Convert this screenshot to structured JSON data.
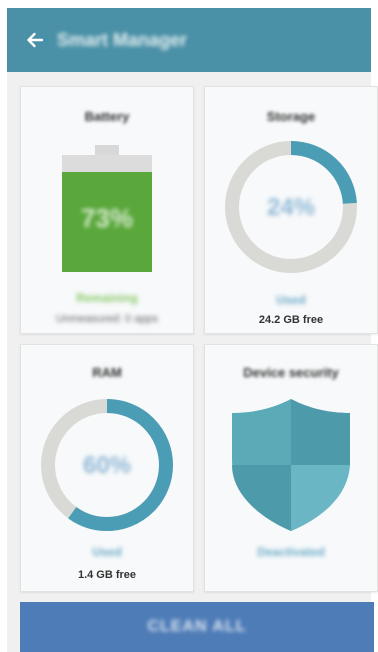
{
  "header": {
    "title": "Smart Manager",
    "back_icon": "back-arrow-icon"
  },
  "battery": {
    "title": "Battery",
    "percent_text": "73%",
    "level": 0.73,
    "status": "Remaining",
    "time_text": "Unmeasured: 0 apps",
    "color": "#5aa83c"
  },
  "storage": {
    "title": "Storage",
    "percent_text": "24%",
    "used_fraction": 0.24,
    "status": "Used",
    "free_text": "24.2 GB free",
    "color": "#4a9db4"
  },
  "ram": {
    "title": "RAM",
    "percent_text": "60%",
    "used_fraction": 0.6,
    "status": "Used",
    "free_text": "1.4 GB free",
    "color": "#4a9db4"
  },
  "security": {
    "title": "Device security",
    "status": "Deactivated",
    "shield_icon": "shield-icon",
    "color": "#5aaab8"
  },
  "footer": {
    "clean_label": "CLEAN ALL",
    "color": "#4e7cb7"
  }
}
